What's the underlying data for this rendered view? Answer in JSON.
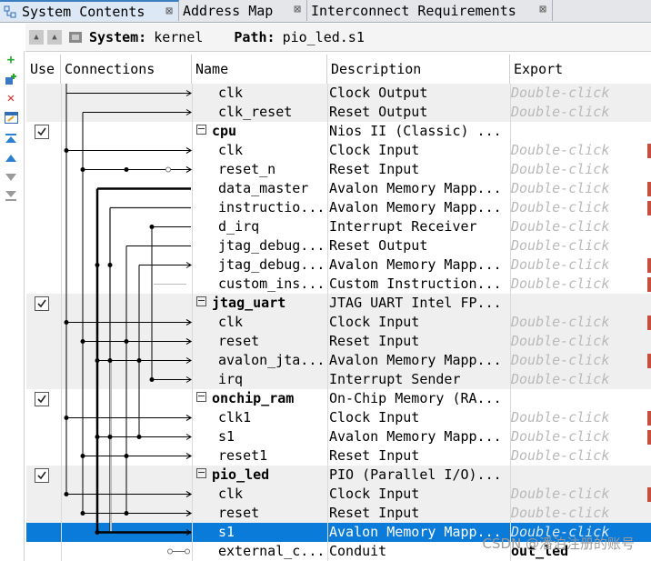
{
  "tabs": [
    {
      "label": "System Contents",
      "close": "⊠"
    },
    {
      "label": "Address Map",
      "close": "⊠"
    },
    {
      "label": "Interconnect Requirements",
      "close": "⊠"
    }
  ],
  "pathbar": {
    "system_label": "System:",
    "system_value": "kernel",
    "path_label": "Path:",
    "path_value": "pio_led.s1"
  },
  "columns": {
    "use": "Use",
    "connections": "Connections",
    "name": "Name",
    "description": "Description",
    "export": "Export"
  },
  "export_placeholder": "Double-click",
  "rows": [
    {
      "type": "iface",
      "name": "clk",
      "desc": "Clock Output",
      "export": "Double-click",
      "alt": true
    },
    {
      "type": "iface",
      "name": "clk_reset",
      "desc": "Reset Output",
      "export": "Double-click",
      "alt": true
    },
    {
      "type": "comp",
      "name": "cpu",
      "desc": "Nios II (Classic) ...",
      "checked": true
    },
    {
      "type": "iface",
      "name": "clk",
      "desc": "Clock Input",
      "export": "Double-click"
    },
    {
      "type": "iface",
      "name": "reset_n",
      "desc": "Reset Input",
      "export": "Double-click"
    },
    {
      "type": "iface",
      "name": "data_master",
      "desc": "Avalon Memory Mapp...",
      "export": "Double-click"
    },
    {
      "type": "iface",
      "name": "instructio...",
      "desc": "Avalon Memory Mapp...",
      "export": "Double-click"
    },
    {
      "type": "iface",
      "name": "d_irq",
      "desc": "Interrupt Receiver",
      "export": "Double-click"
    },
    {
      "type": "iface",
      "name": "jtag_debug...",
      "desc": "Reset Output",
      "export": "Double-click"
    },
    {
      "type": "iface",
      "name": "jtag_debug...",
      "desc": "Avalon Memory Mapp...",
      "export": "Double-click"
    },
    {
      "type": "iface",
      "name": "custom_ins...",
      "desc": "Custom Instruction...",
      "export": "Double-click"
    },
    {
      "type": "comp",
      "name": "jtag_uart",
      "desc": "JTAG UART Intel FP...",
      "checked": true,
      "alt": true
    },
    {
      "type": "iface",
      "name": "clk",
      "desc": "Clock Input",
      "export": "Double-click",
      "alt": true
    },
    {
      "type": "iface",
      "name": "reset",
      "desc": "Reset Input",
      "export": "Double-click",
      "alt": true
    },
    {
      "type": "iface",
      "name": "avalon_jta...",
      "desc": "Avalon Memory Mapp...",
      "export": "Double-click",
      "alt": true
    },
    {
      "type": "iface",
      "name": "irq",
      "desc": "Interrupt Sender",
      "export": "Double-click",
      "alt": true
    },
    {
      "type": "comp",
      "name": "onchip_ram",
      "desc": "On-Chip Memory (RA...",
      "checked": true
    },
    {
      "type": "iface",
      "name": "clk1",
      "desc": "Clock Input",
      "export": "Double-click"
    },
    {
      "type": "iface",
      "name": "s1",
      "desc": "Avalon Memory Mapp...",
      "export": "Double-click"
    },
    {
      "type": "iface",
      "name": "reset1",
      "desc": "Reset Input",
      "export": "Double-click"
    },
    {
      "type": "comp",
      "name": "pio_led",
      "desc": "PIO (Parallel I/O)...",
      "checked": true,
      "alt": true
    },
    {
      "type": "iface",
      "name": "clk",
      "desc": "Clock Input",
      "export": "Double-click",
      "alt": true
    },
    {
      "type": "iface",
      "name": "reset",
      "desc": "Reset Input",
      "export": "Double-click",
      "alt": true
    },
    {
      "type": "iface",
      "name": "s1",
      "desc": "Avalon Memory Mapp...",
      "export": "Double-click",
      "selected": true
    },
    {
      "type": "iface",
      "name": "external_c...",
      "desc": "Conduit",
      "export": "out_led"
    }
  ],
  "watermark": "CSDN @潘泊注册的账号",
  "colors": {
    "selection": "#0a7bd9",
    "tab_active": "#dce8f6",
    "placeholder": "#b9b9b9",
    "alt_row": "#efefef"
  }
}
